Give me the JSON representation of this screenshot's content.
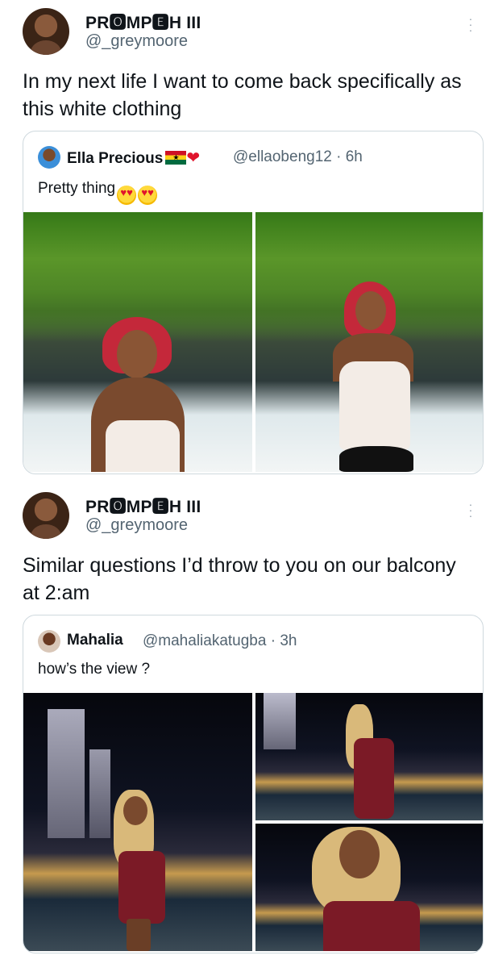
{
  "tweets": [
    {
      "display_name": "PR🅾MP🅴H III",
      "handle": "@_greymoore",
      "text": "In my next life I want to come back specifically as this white clothing",
      "quote": {
        "name": "Ella Precious",
        "handle": "@ellaobeng12 · 6h",
        "text": "Pretty thing",
        "photos": [
          "photo-garden-1",
          "photo-garden-2"
        ]
      }
    },
    {
      "display_name": "PR🅾MP🅴H III",
      "handle": "@_greymoore",
      "text": "Similar questions I’d throw to you on our balcony at 2:am",
      "quote": {
        "name": "Mahalia",
        "handle": "@mahaliakatugba · 3h",
        "text": "how’s the view ?",
        "photos": [
          "photo-city-1",
          "photo-city-2",
          "photo-city-3"
        ]
      }
    }
  ],
  "icons": {
    "more": "more-vertical-icon",
    "flag": "ghana-flag-icon",
    "heart": "red-heart-icon",
    "emoji": "heart-eyes-emoji-icon"
  },
  "colors": {
    "text": "#0f1419",
    "secondary": "#536471",
    "border": "#cfd9de"
  }
}
